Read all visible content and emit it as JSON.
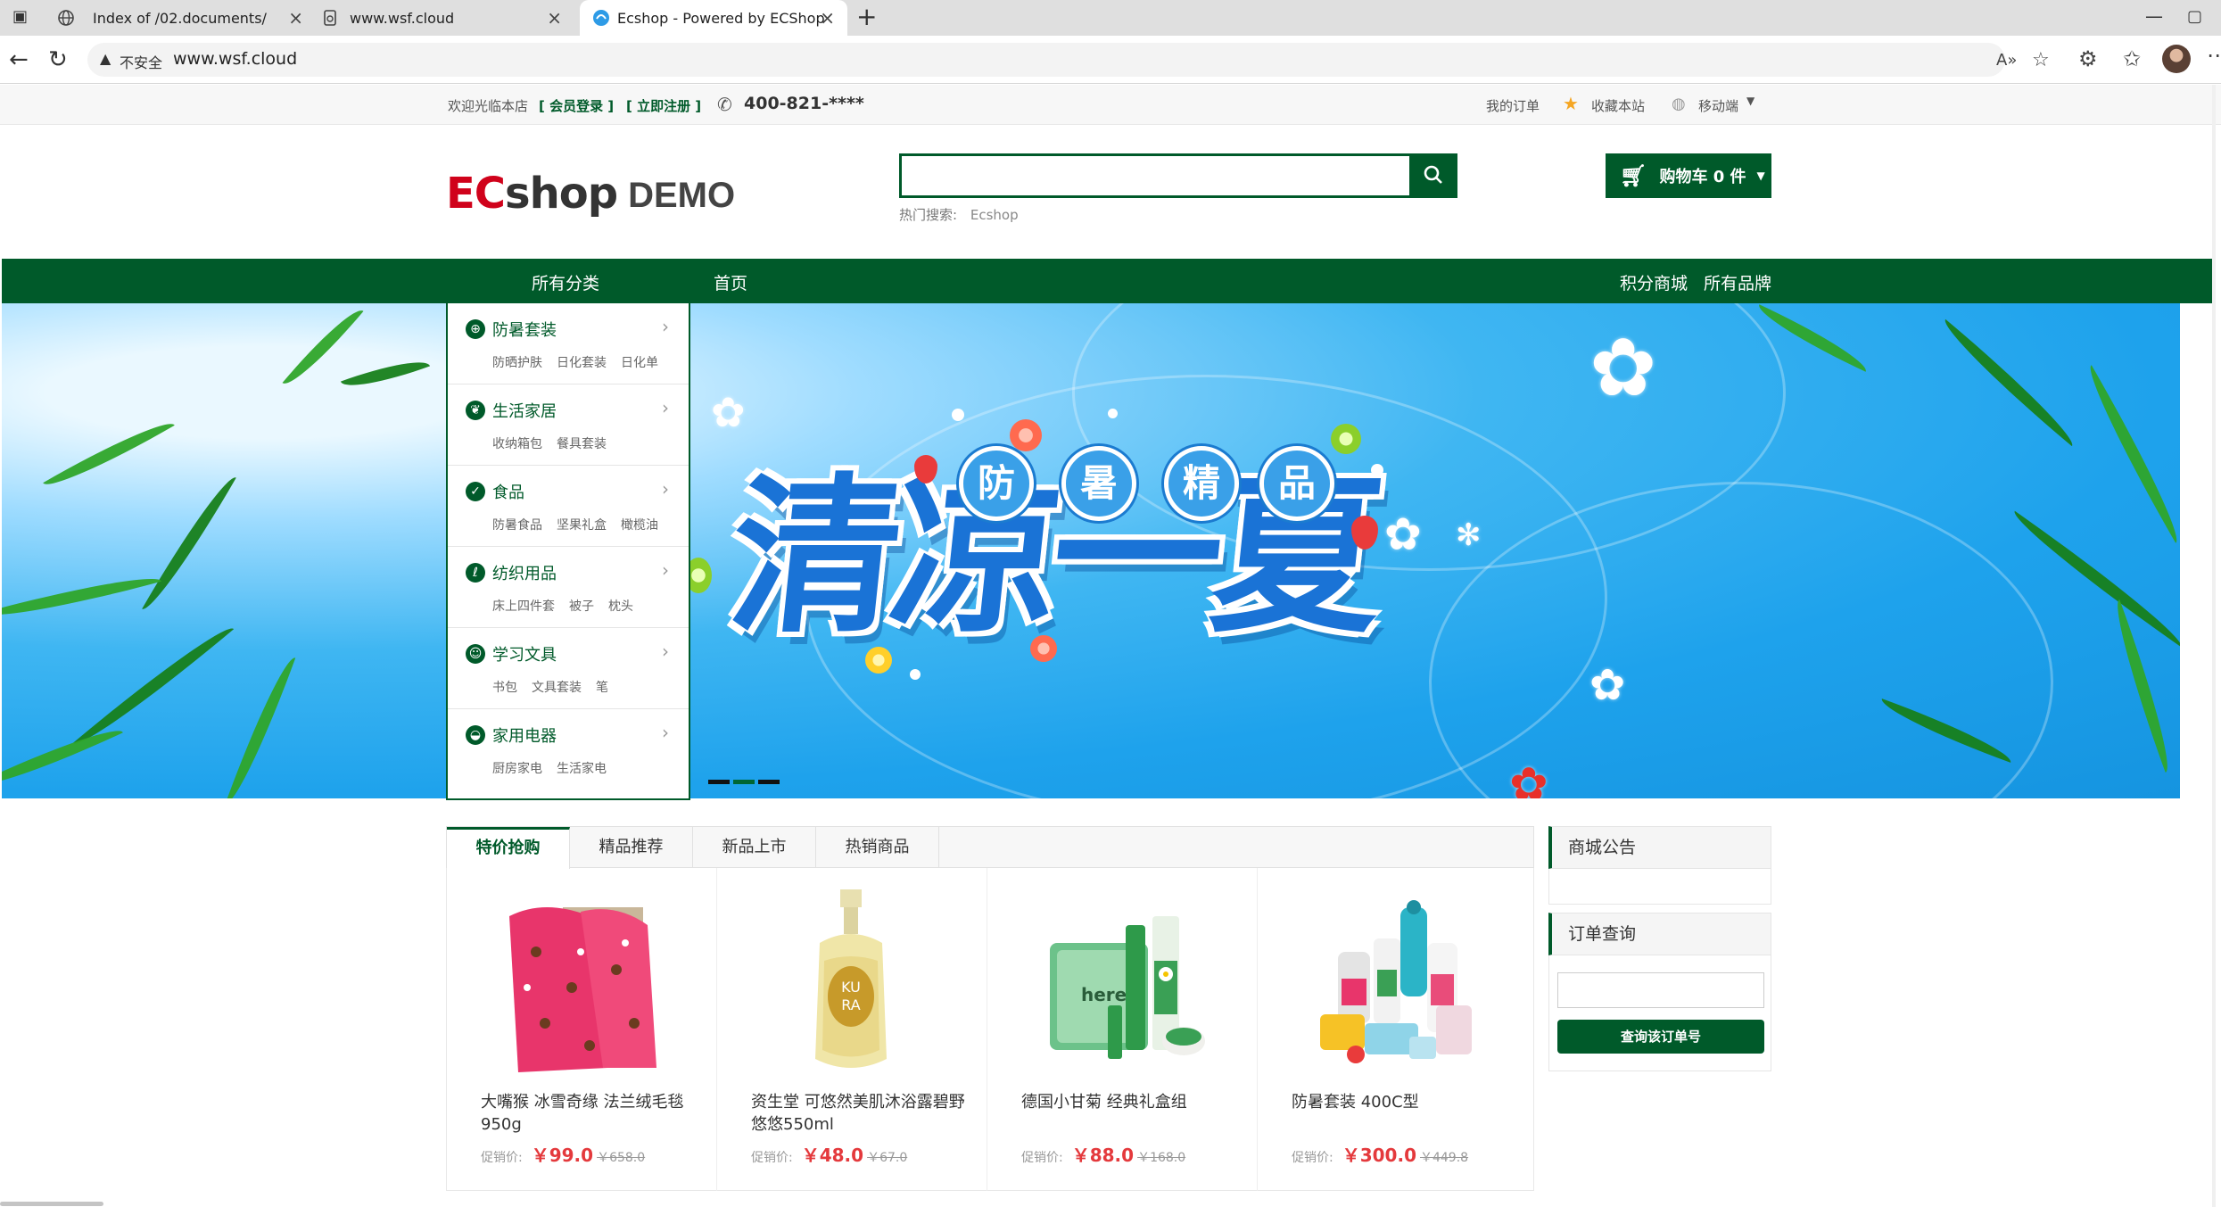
{
  "browser": {
    "tabs": [
      {
        "title": "Index of /02.documents/",
        "icon": "globe-icon"
      },
      {
        "title": "www.wsf.cloud",
        "icon": "page-icon"
      },
      {
        "title": "Ecshop - Powered by ECShop",
        "icon": "site-icon"
      }
    ],
    "new_tab": "+",
    "address": {
      "security_label": "不安全",
      "url": "www.wsf.cloud"
    },
    "controls": {
      "minimize": "—",
      "maximize": "▢"
    }
  },
  "topstrip": {
    "welcome": "欢迎光临本店",
    "login_link": "[ 会员登录 ]",
    "register_link": "[ 立即注册 ]",
    "phone": "400-821-****",
    "my_orders": "我的订单",
    "favorite": "收藏本站",
    "mobile": "移动端"
  },
  "header": {
    "logo_a": "EC",
    "logo_b": "shop",
    "logo_c": "DEMO",
    "search_placeholder": "",
    "hot_label": "热门搜索:",
    "hot_keywords": [
      "Ecshop"
    ],
    "cart_label": "购物车 0 件"
  },
  "nav": {
    "all_categories": "所有分类",
    "home": "首页",
    "points_mall": "积分商城",
    "all_brands": "所有品牌"
  },
  "banner": {
    "title": "清凉一夏",
    "circles": [
      "防",
      "暑",
      "精",
      "品"
    ],
    "slide_count": 3,
    "active_slide": 1
  },
  "categories": [
    {
      "name": "防暑套装",
      "icon": "cross-icon",
      "subs": [
        "防晒护肤",
        "日化套装",
        "日化单"
      ]
    },
    {
      "name": "生活家居",
      "icon": "leaf-icon",
      "subs": [
        "收纳箱包",
        "餐具套装"
      ]
    },
    {
      "name": "食品",
      "icon": "check-icon",
      "subs": [
        "防暑食品",
        "坚果礼盒",
        "橄榄油"
      ]
    },
    {
      "name": "纺织用品",
      "icon": "sprout-icon",
      "subs": [
        "床上四件套",
        "被子",
        "枕头"
      ]
    },
    {
      "name": "学习文具",
      "icon": "person-icon",
      "subs": [
        "书包",
        "文具套装",
        "笔"
      ]
    },
    {
      "name": "家用电器",
      "icon": "bowl-icon",
      "subs": [
        "厨房家电",
        "生活家电"
      ]
    }
  ],
  "product_tabs": [
    "特价抢购",
    "精品推荐",
    "新品上市",
    "热销商品"
  ],
  "products": [
    {
      "name": "大嘴猴 冰雪奇缘 法兰绒毛毯950g",
      "price_label": "促销价:",
      "price": "￥99.0",
      "original": "￥658.0"
    },
    {
      "name": "资生堂 可悠然美肌沐浴露碧野悠悠550ml",
      "price_label": "促销价:",
      "price": "￥48.0",
      "original": "￥67.0"
    },
    {
      "name": "德国小甘菊 经典礼盒组",
      "price_label": "促销价:",
      "price": "￥88.0",
      "original": "￥168.0"
    },
    {
      "name": "防暑套装 400C型",
      "price_label": "促销价:",
      "price": "￥300.0",
      "original": "￥449.8"
    }
  ],
  "sidebar": {
    "notice_title": "商城公告",
    "order_title": "订单查询",
    "order_input_placeholder": "",
    "order_button": "查询该订单号"
  },
  "colors": {
    "brand_green": "#005a2a",
    "price_red": "#e4393c",
    "banner_blue": "#1ea2ec"
  }
}
